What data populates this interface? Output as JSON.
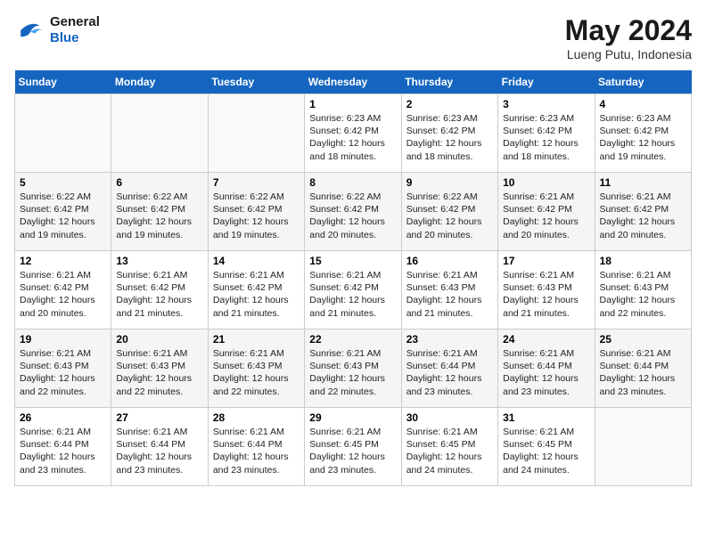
{
  "header": {
    "logo_line1": "General",
    "logo_line2": "Blue",
    "month": "May 2024",
    "location": "Lueng Putu, Indonesia"
  },
  "weekdays": [
    "Sunday",
    "Monday",
    "Tuesday",
    "Wednesday",
    "Thursday",
    "Friday",
    "Saturday"
  ],
  "weeks": [
    [
      {
        "day": "",
        "info": ""
      },
      {
        "day": "",
        "info": ""
      },
      {
        "day": "",
        "info": ""
      },
      {
        "day": "1",
        "info": "Sunrise: 6:23 AM\nSunset: 6:42 PM\nDaylight: 12 hours and 18 minutes."
      },
      {
        "day": "2",
        "info": "Sunrise: 6:23 AM\nSunset: 6:42 PM\nDaylight: 12 hours and 18 minutes."
      },
      {
        "day": "3",
        "info": "Sunrise: 6:23 AM\nSunset: 6:42 PM\nDaylight: 12 hours and 18 minutes."
      },
      {
        "day": "4",
        "info": "Sunrise: 6:23 AM\nSunset: 6:42 PM\nDaylight: 12 hours and 19 minutes."
      }
    ],
    [
      {
        "day": "5",
        "info": "Sunrise: 6:22 AM\nSunset: 6:42 PM\nDaylight: 12 hours and 19 minutes."
      },
      {
        "day": "6",
        "info": "Sunrise: 6:22 AM\nSunset: 6:42 PM\nDaylight: 12 hours and 19 minutes."
      },
      {
        "day": "7",
        "info": "Sunrise: 6:22 AM\nSunset: 6:42 PM\nDaylight: 12 hours and 19 minutes."
      },
      {
        "day": "8",
        "info": "Sunrise: 6:22 AM\nSunset: 6:42 PM\nDaylight: 12 hours and 20 minutes."
      },
      {
        "day": "9",
        "info": "Sunrise: 6:22 AM\nSunset: 6:42 PM\nDaylight: 12 hours and 20 minutes."
      },
      {
        "day": "10",
        "info": "Sunrise: 6:21 AM\nSunset: 6:42 PM\nDaylight: 12 hours and 20 minutes."
      },
      {
        "day": "11",
        "info": "Sunrise: 6:21 AM\nSunset: 6:42 PM\nDaylight: 12 hours and 20 minutes."
      }
    ],
    [
      {
        "day": "12",
        "info": "Sunrise: 6:21 AM\nSunset: 6:42 PM\nDaylight: 12 hours and 20 minutes."
      },
      {
        "day": "13",
        "info": "Sunrise: 6:21 AM\nSunset: 6:42 PM\nDaylight: 12 hours and 21 minutes."
      },
      {
        "day": "14",
        "info": "Sunrise: 6:21 AM\nSunset: 6:42 PM\nDaylight: 12 hours and 21 minutes."
      },
      {
        "day": "15",
        "info": "Sunrise: 6:21 AM\nSunset: 6:42 PM\nDaylight: 12 hours and 21 minutes."
      },
      {
        "day": "16",
        "info": "Sunrise: 6:21 AM\nSunset: 6:43 PM\nDaylight: 12 hours and 21 minutes."
      },
      {
        "day": "17",
        "info": "Sunrise: 6:21 AM\nSunset: 6:43 PM\nDaylight: 12 hours and 21 minutes."
      },
      {
        "day": "18",
        "info": "Sunrise: 6:21 AM\nSunset: 6:43 PM\nDaylight: 12 hours and 22 minutes."
      }
    ],
    [
      {
        "day": "19",
        "info": "Sunrise: 6:21 AM\nSunset: 6:43 PM\nDaylight: 12 hours and 22 minutes."
      },
      {
        "day": "20",
        "info": "Sunrise: 6:21 AM\nSunset: 6:43 PM\nDaylight: 12 hours and 22 minutes."
      },
      {
        "day": "21",
        "info": "Sunrise: 6:21 AM\nSunset: 6:43 PM\nDaylight: 12 hours and 22 minutes."
      },
      {
        "day": "22",
        "info": "Sunrise: 6:21 AM\nSunset: 6:43 PM\nDaylight: 12 hours and 22 minutes."
      },
      {
        "day": "23",
        "info": "Sunrise: 6:21 AM\nSunset: 6:44 PM\nDaylight: 12 hours and 23 minutes."
      },
      {
        "day": "24",
        "info": "Sunrise: 6:21 AM\nSunset: 6:44 PM\nDaylight: 12 hours and 23 minutes."
      },
      {
        "day": "25",
        "info": "Sunrise: 6:21 AM\nSunset: 6:44 PM\nDaylight: 12 hours and 23 minutes."
      }
    ],
    [
      {
        "day": "26",
        "info": "Sunrise: 6:21 AM\nSunset: 6:44 PM\nDaylight: 12 hours and 23 minutes."
      },
      {
        "day": "27",
        "info": "Sunrise: 6:21 AM\nSunset: 6:44 PM\nDaylight: 12 hours and 23 minutes."
      },
      {
        "day": "28",
        "info": "Sunrise: 6:21 AM\nSunset: 6:44 PM\nDaylight: 12 hours and 23 minutes."
      },
      {
        "day": "29",
        "info": "Sunrise: 6:21 AM\nSunset: 6:45 PM\nDaylight: 12 hours and 23 minutes."
      },
      {
        "day": "30",
        "info": "Sunrise: 6:21 AM\nSunset: 6:45 PM\nDaylight: 12 hours and 24 minutes."
      },
      {
        "day": "31",
        "info": "Sunrise: 6:21 AM\nSunset: 6:45 PM\nDaylight: 12 hours and 24 minutes."
      },
      {
        "day": "",
        "info": ""
      }
    ]
  ]
}
